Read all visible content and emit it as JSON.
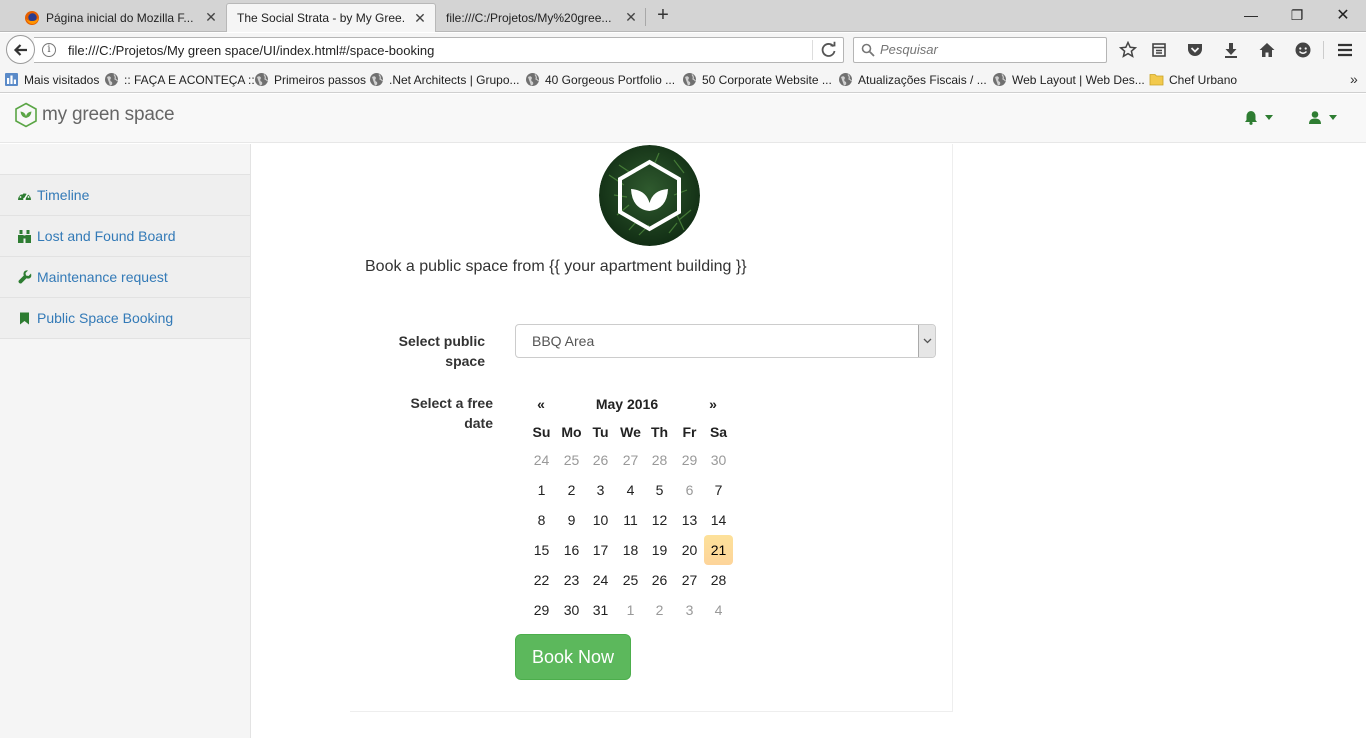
{
  "browser": {
    "tabs": [
      {
        "label": "Página inicial do Mozilla F...",
        "active": false
      },
      {
        "label": "The Social Strata - by My Gree...",
        "active": true
      },
      {
        "label": "file:///C:/Projetos/My%20gree...",
        "active": false
      }
    ],
    "new_tab_glyph": "+",
    "tab_close_glyph": "✕",
    "window_controls": {
      "minimize": "—",
      "restore": "❐",
      "close": "✕"
    },
    "url": "file:///C:/Projetos/My green space/UI/index.html#/space-booking",
    "url_info_glyph": "i",
    "search_placeholder": "Pesquisar",
    "bookmarks": [
      {
        "label": "Mais visitados",
        "icon": "most-visited-icon"
      },
      {
        "label": ":: FAÇA E ACONTEÇA ::",
        "icon": "globe-icon"
      },
      {
        "label": "Primeiros passos",
        "icon": "globe-icon"
      },
      {
        "label": ".Net Architects | Grupo...",
        "icon": "globe-icon"
      },
      {
        "label": "40 Gorgeous Portfolio ...",
        "icon": "globe-icon"
      },
      {
        "label": "50 Corporate Website ...",
        "icon": "globe-icon"
      },
      {
        "label": "Atualizações Fiscais / ...",
        "icon": "globe-icon"
      },
      {
        "label": "Web Layout | Web Des...",
        "icon": "globe-icon"
      },
      {
        "label": "Chef Urbano",
        "icon": "folder-icon"
      }
    ],
    "bookmarks_more": "»"
  },
  "app": {
    "brand": "my green space",
    "accent_color": "#2e7d32",
    "link_color": "#337ab7"
  },
  "sidebar": {
    "items": [
      {
        "label": "Timeline",
        "icon": "dashboard-icon"
      },
      {
        "label": "Lost and Found Board",
        "icon": "binoculars-icon"
      },
      {
        "label": "Maintenance request",
        "icon": "wrench-icon"
      },
      {
        "label": "Public Space Booking",
        "icon": "bookmark-icon"
      }
    ]
  },
  "main": {
    "intro": "Book a public space from {{ your apartment building }}",
    "select_label_line1": "Select public",
    "select_label_line2": "space",
    "select_value": "BBQ Area",
    "date_label_line1": "Select a free",
    "date_label_line2": "date",
    "book_button": "Book Now"
  },
  "calendar": {
    "prev": "«",
    "next": "»",
    "title": "May 2016",
    "weekdays": [
      "Su",
      "Mo",
      "Tu",
      "We",
      "Th",
      "Fr",
      "Sa"
    ],
    "weeks": [
      [
        "24",
        "25",
        "26",
        "27",
        "28",
        "29",
        "30"
      ],
      [
        "1",
        "2",
        "3",
        "4",
        "5",
        "6",
        "7"
      ],
      [
        "8",
        "9",
        "10",
        "11",
        "12",
        "13",
        "14"
      ],
      [
        "15",
        "16",
        "17",
        "18",
        "19",
        "20",
        "21"
      ],
      [
        "22",
        "23",
        "24",
        "25",
        "26",
        "27",
        "28"
      ],
      [
        "29",
        "30",
        "31",
        "1",
        "2",
        "3",
        "4"
      ]
    ],
    "today": "21",
    "disabled_days": [
      "6"
    ]
  }
}
